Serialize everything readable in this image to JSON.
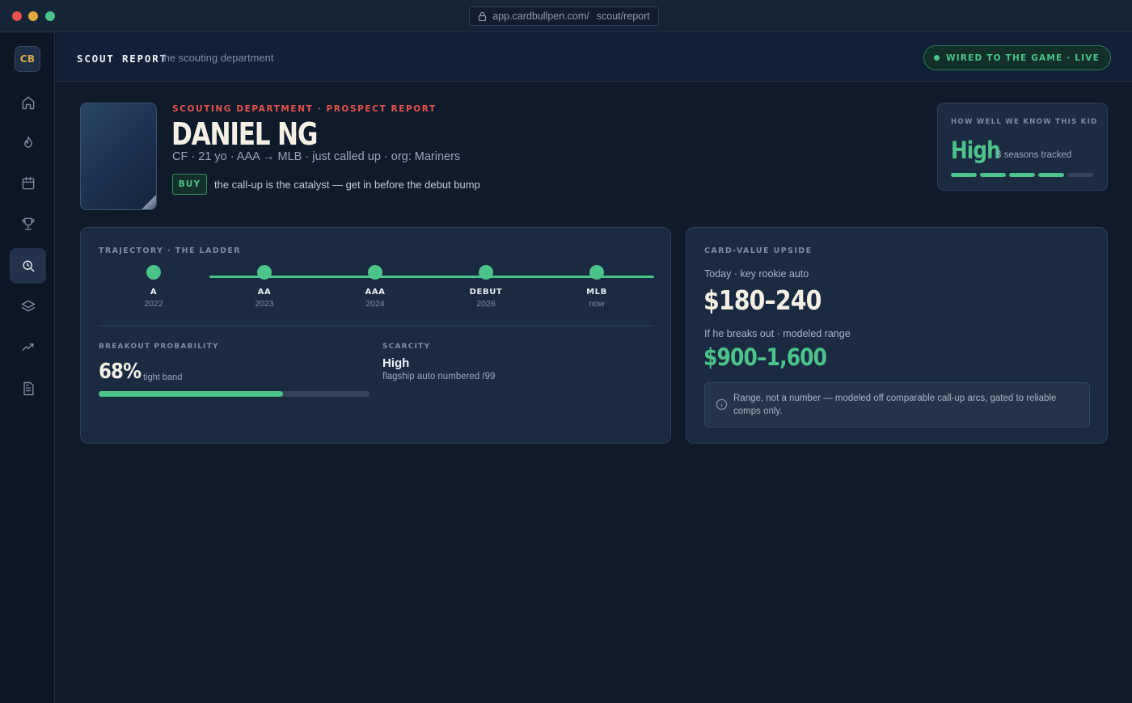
{
  "browser": {
    "url_host": "app.cardbullpen.com/",
    "url_path": "scout/report"
  },
  "sidebar": {
    "logo": "CB",
    "items": [
      {
        "icon": "home-icon"
      },
      {
        "icon": "flame-icon"
      },
      {
        "icon": "calendar-icon"
      },
      {
        "icon": "trophy-icon"
      },
      {
        "icon": "scout-search-icon",
        "active": true
      },
      {
        "icon": "layers-icon"
      },
      {
        "icon": "trend-icon"
      },
      {
        "icon": "report-icon"
      }
    ]
  },
  "header": {
    "title": "SCOUT REPORT",
    "subtitle": "the scouting department",
    "live_status": "WIRED TO THE GAME · LIVE"
  },
  "profile": {
    "eyebrow": "SCOUTING DEPARTMENT · PROSPECT REPORT",
    "name": "DANIEL NG",
    "meta": "CF · 21 yo · AAA → MLB · just called up · org: Mariners",
    "verdict": "BUY",
    "verdict_note": "the call-up is the catalyst — get in before the debut bump"
  },
  "confidence": {
    "label": "HOW WELL WE KNOW THIS KID",
    "value": "High",
    "detail": "3 seasons tracked",
    "segments_filled": 4,
    "segments_total": 5
  },
  "trajectory": {
    "label": "TRAJECTORY · THE LADDER",
    "rungs": [
      {
        "level": "A",
        "year": "2022"
      },
      {
        "level": "AA",
        "year": "2023"
      },
      {
        "level": "AAA",
        "year": "2024"
      },
      {
        "level": "DEBUT",
        "year": "2026"
      },
      {
        "level": "MLB",
        "year": "now"
      }
    ],
    "breakout": {
      "label": "BREAKOUT PROBABILITY",
      "value": "68%",
      "detail": "tight band",
      "fraction": 0.68
    },
    "scarcity": {
      "label": "SCARCITY",
      "value": "High",
      "detail": "flagship auto numbered /99"
    }
  },
  "upside": {
    "label": "CARD-VALUE UPSIDE",
    "today_label": "Today · key rookie auto",
    "today_value": "$180–240",
    "breakout_label": "If he breaks out · modeled range",
    "breakout_value": "$900–1,600",
    "note": "Range, not a number — modeled off comparable call-up arcs, gated to reliable comps only."
  },
  "colors": {
    "accent_green": "#4cc38a",
    "accent_red": "#e5534b",
    "logo_gold": "#d9a84e",
    "background": "#0f1a2b"
  }
}
